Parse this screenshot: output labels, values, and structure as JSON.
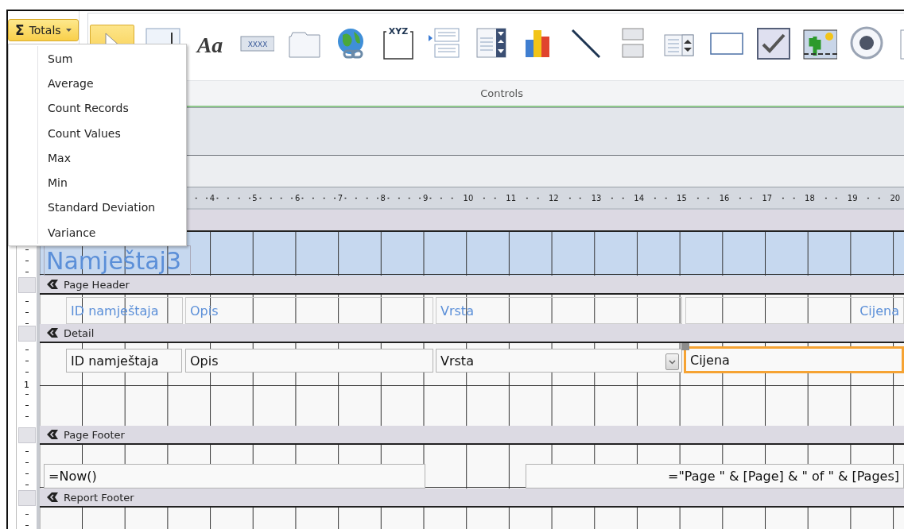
{
  "ribbon": {
    "totals_button": {
      "icon_glyph": "Σ",
      "label": "Totals",
      "expanded": true
    },
    "controls_group": {
      "label": "Controls",
      "tools": [
        {
          "kind": "select",
          "selected": true
        },
        {
          "kind": "textbox",
          "selected": false
        },
        {
          "kind": "label",
          "glyph": "Aa",
          "selected": false
        },
        {
          "kind": "button",
          "glyph": "XXXX",
          "selected": false
        },
        {
          "kind": "tab",
          "selected": false
        },
        {
          "kind": "hyperlink",
          "selected": false
        },
        {
          "kind": "browser",
          "glyph": "XYZ",
          "selected": false
        },
        {
          "kind": "navigation",
          "selected": false
        },
        {
          "kind": "combobox",
          "selected": false
        },
        {
          "kind": "chart",
          "selected": false
        },
        {
          "kind": "line",
          "selected": false
        },
        {
          "kind": "toggle",
          "selected": false
        },
        {
          "kind": "listbox",
          "selected": false
        },
        {
          "kind": "rectangle",
          "selected": false
        },
        {
          "kind": "checkbox",
          "selected": false
        },
        {
          "kind": "image",
          "selected": false
        },
        {
          "kind": "option",
          "selected": false
        },
        {
          "kind": "more",
          "selected": false
        }
      ]
    }
  },
  "totals_menu": [
    {
      "label": "Sum"
    },
    {
      "label": "Average"
    },
    {
      "label": "Count Records"
    },
    {
      "label": "Count Values"
    },
    {
      "label": "Max"
    },
    {
      "label": "Min"
    },
    {
      "label": "Standard Deviation"
    },
    {
      "label": "Variance"
    }
  ],
  "ruler": [
    "4",
    "5",
    "6",
    "7",
    "8",
    "9",
    "10",
    "11",
    "12",
    "13",
    "14",
    "15",
    "16",
    "17",
    "18",
    "19",
    "20"
  ],
  "sections": [
    {
      "kind": "report_header",
      "controls": [
        {
          "kind": "title",
          "text": "Namještaj3",
          "selected": false
        }
      ]
    },
    {
      "kind": "page_header",
      "title": "Page Header",
      "controls": [
        {
          "kind": "label",
          "text": "ID namještaja",
          "selected": false
        },
        {
          "kind": "label",
          "text": "Opis",
          "selected": false
        },
        {
          "kind": "label",
          "text": "Vrsta",
          "selected": false
        },
        {
          "kind": "label",
          "text": "Cijena",
          "selected": false
        }
      ]
    },
    {
      "kind": "detail",
      "title": "Detail",
      "ruler_mark": "1",
      "controls": [
        {
          "kind": "textbox",
          "text": "ID namještaja",
          "selected": false
        },
        {
          "kind": "textbox",
          "text": "Opis",
          "selected": false
        },
        {
          "kind": "combobox",
          "text": "Vrsta",
          "selected": false
        },
        {
          "kind": "textbox",
          "text": "Cijena",
          "selected": true
        }
      ]
    },
    {
      "kind": "page_footer",
      "title": "Page Footer",
      "controls": [
        {
          "kind": "textbox",
          "text": "=Now()",
          "selected": false
        },
        {
          "kind": "textbox",
          "text": "=\"Page \" & [Page] & \" of \" & [Pages]",
          "selected": false
        }
      ]
    },
    {
      "kind": "report_footer",
      "title": "Report Footer"
    }
  ]
}
